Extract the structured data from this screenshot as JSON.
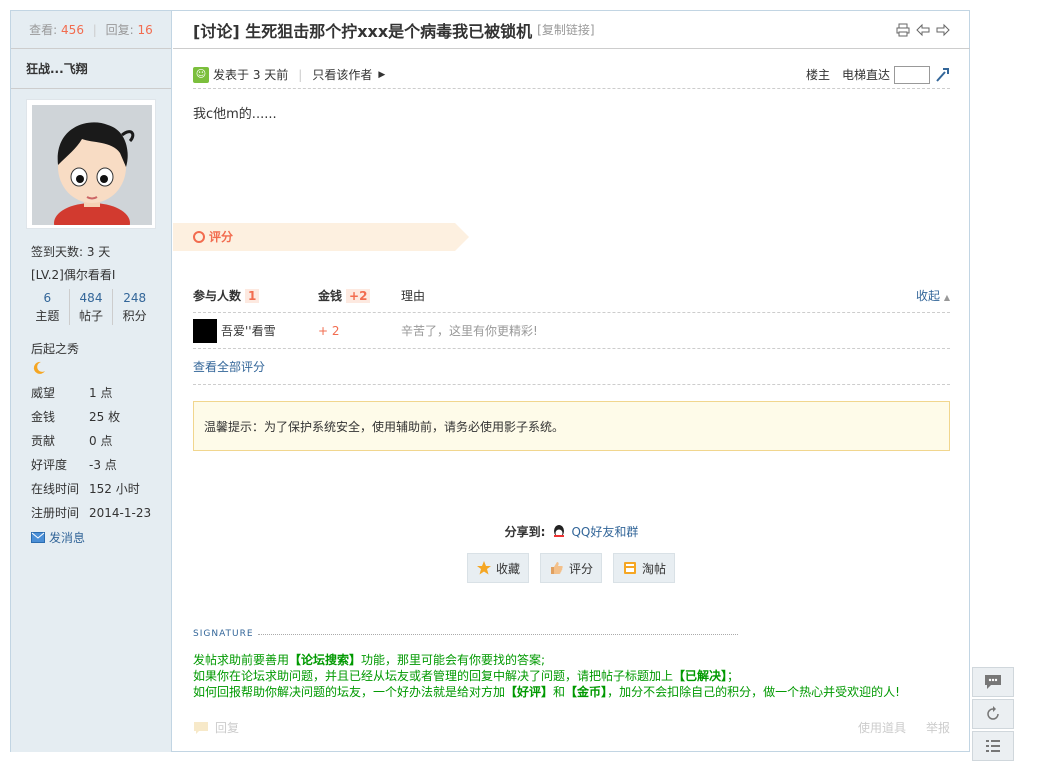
{
  "sidebar": {
    "views_label": "查看:",
    "views": "456",
    "replies_label": "回复:",
    "replies": "16",
    "username": "狂战...飞翔",
    "checkin": "签到天数: 3 天",
    "level": "[LV.2]偶尔看看I",
    "counts": [
      {
        "value": "6",
        "label": "主题"
      },
      {
        "value": "484",
        "label": "帖子"
      },
      {
        "value": "248",
        "label": "积分"
      }
    ],
    "title": "后起之秀",
    "profile": [
      {
        "key": "威望",
        "value": "1 点"
      },
      {
        "key": "金钱",
        "value": "25 枚"
      },
      {
        "key": "贡献",
        "value": "0 点"
      },
      {
        "key": "好评度",
        "value": "-3 点"
      },
      {
        "key": "在线时间",
        "value": "152 小时"
      },
      {
        "key": "注册时间",
        "value": "2014-1-23"
      }
    ],
    "pm": "发消息"
  },
  "post": {
    "title": "[讨论] 生死狙击那个拧xxx是个病毒我已被锁机",
    "copy_link": "[复制链接]",
    "posted": "发表于 3 天前",
    "only_author": "只看该作者",
    "floor": "楼主",
    "elevator": "电梯直达",
    "content": "我c他m的......"
  },
  "rating": {
    "tag": "评分",
    "head_people": "参与人数",
    "people_count": "1",
    "head_money": "金钱",
    "money_total": "+2",
    "head_reason": "理由",
    "collapse": "收起",
    "rows": [
      {
        "user": "吾爱''看雪",
        "money": "+ 2",
        "reason": "辛苦了，这里有你更精彩!"
      }
    ],
    "view_all": "查看全部评分"
  },
  "notice": "温馨提示：为了保护系统安全，使用辅助前，请务必使用影子系统。",
  "share": {
    "label": "分享到:",
    "qq": "QQ好友和群",
    "favorite": "收藏",
    "rate": "评分",
    "taotie": "淘帖"
  },
  "signature": {
    "head": "SIGNATURE",
    "line1_a": "发帖求助前要善用",
    "line1_b": "【论坛搜索】",
    "line1_c": "功能，那里可能会有你要找的答案;",
    "line2_a": "如果你在论坛求助问题，并且已经从坛友或者管理的回复中解决了问题，请把帖子标题加上",
    "line2_b": "【已解决】",
    "line2_c": "；",
    "line3_a": "如何回报帮助你解决问题的坛友，一个好办法就是给对方加",
    "line3_b": "【好评】",
    "line3_c": "和",
    "line3_d": "【金币】",
    "line3_e": "，加分不会扣除自己的积分，做一个热心并受欢迎的人!"
  },
  "footer": {
    "reply": "回复",
    "tools": "使用道具",
    "report": "举报"
  }
}
